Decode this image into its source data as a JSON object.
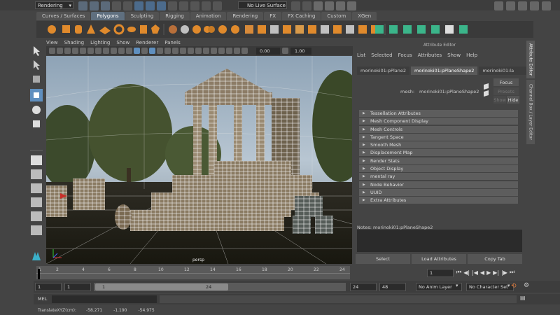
{
  "status": {
    "menu_set": "Rendering",
    "live_surface": "No Live Surface"
  },
  "shelf_tabs": [
    "Curves / Surfaces",
    "Polygons",
    "Sculpting",
    "Rigging",
    "Animation",
    "Rendering",
    "FX",
    "FX Caching",
    "Custom",
    "XGen"
  ],
  "active_shelf": "Polygons",
  "viewport": {
    "menu": [
      "View",
      "Shading",
      "Lighting",
      "Show",
      "Renderer",
      "Panels"
    ],
    "field1": "0.00",
    "field2": "1.00",
    "camera_label": "persp"
  },
  "attribute_editor": {
    "title": "Attribute Editor",
    "menu": [
      "List",
      "Selected",
      "Focus",
      "Attributes",
      "Show",
      "Help"
    ],
    "tabs": [
      "morinoki01:pPlane2",
      "morinoki01:pPlaneShape2",
      "morinoki01:la"
    ],
    "mesh_label": "mesh:",
    "mesh_value": "morinoki01:pPlaneShape2",
    "focus": "Focus",
    "presets": "Presets",
    "show": "Show",
    "hide": "Hide",
    "sections": [
      "Tessellation Attributes",
      "Mesh Component Display",
      "Mesh Controls",
      "Tangent Space",
      "Smooth Mesh",
      "Displacement Map",
      "Render Stats",
      "Object Display",
      "mental ray",
      "Node Behavior",
      "UUID",
      "Extra Attributes"
    ],
    "notes": "Notes:  morinoki01:pPlaneShape2",
    "buttons": [
      "Select",
      "Load Attributes",
      "Copy Tab"
    ]
  },
  "side_tabs": [
    "Attribute Editor",
    "Channel Box / Layer Editor"
  ],
  "time_slider": {
    "ticks": [
      "1",
      "2",
      "4",
      "6",
      "8",
      "10",
      "12",
      "14",
      "16",
      "18",
      "20",
      "22",
      "24"
    ],
    "current": "1"
  },
  "range": {
    "start": "1",
    "playback_start": "1",
    "slider_start": "1",
    "slider_end": "24",
    "playback_end": "24",
    "end": "48",
    "anim_layer": "No Anim Layer",
    "character_set": "No Character Set"
  },
  "mel": {
    "label": "MEL"
  },
  "help_line": {
    "label": "TranslateXYZ(cm):",
    "x": "-58.271",
    "y": "-1.190",
    "z": "-54.975"
  },
  "colors": {
    "accent": "#5f8fbf",
    "viewport_sky": "#a9bccc",
    "wire": "#f0f0f0"
  }
}
